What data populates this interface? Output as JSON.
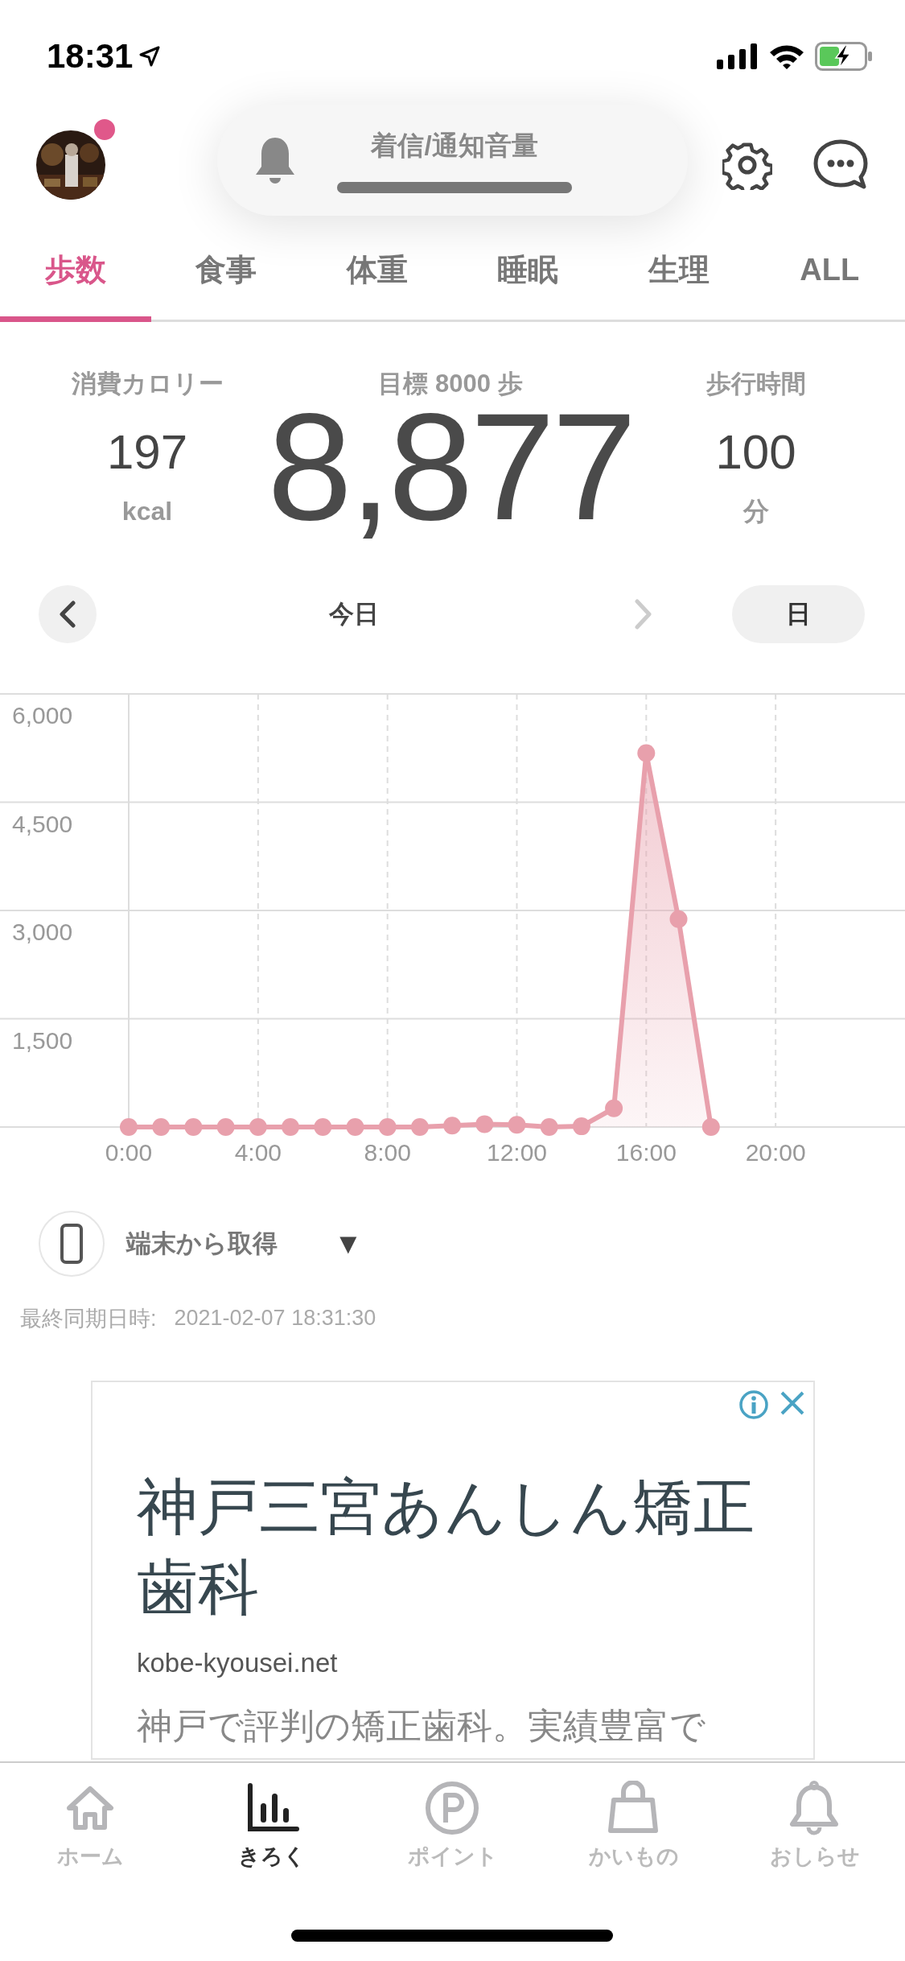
{
  "status_bar": {
    "time": "18:31"
  },
  "header": {
    "notification_dot": true
  },
  "volume_hud": {
    "label": "着信/通知音量",
    "level": 1
  },
  "tabs": [
    {
      "label": "歩数",
      "selected": true
    },
    {
      "label": "食事",
      "selected": false
    },
    {
      "label": "体重",
      "selected": false
    },
    {
      "label": "睡眠",
      "selected": false
    },
    {
      "label": "生理",
      "selected": false
    },
    {
      "label": "ALL",
      "selected": false
    }
  ],
  "stats": [
    {
      "kind": "side",
      "label": "消費カロリー",
      "value": "197",
      "unit": "kcal"
    },
    {
      "kind": "main",
      "label": "目標 8000 歩",
      "value": "8,877"
    },
    {
      "kind": "side",
      "label": "歩行時間",
      "value": "100",
      "unit": "分"
    }
  ],
  "date_nav": {
    "label": "今日",
    "next_enabled": false,
    "period": "日"
  },
  "chart": {
    "chart_data": {
      "type": "area",
      "x": [
        0,
        1,
        2,
        3,
        4,
        5,
        6,
        7,
        8,
        9,
        10,
        11,
        12,
        13,
        14,
        15,
        16,
        17,
        18
      ],
      "grid": true,
      "series": [
        {
          "color": "#e8a0ac",
          "values": [
            0,
            0,
            0,
            0,
            0,
            0,
            0,
            0,
            0,
            0,
            20,
            40,
            30,
            0,
            10,
            260,
            5180,
            2880,
            0
          ]
        }
      ],
      "xlim": [
        0,
        24
      ],
      "ylim": [
        0,
        6000
      ],
      "xticks": [
        {
          "value": 0,
          "label": "0:00"
        },
        {
          "value": 4,
          "label": "4:00"
        },
        {
          "value": 8,
          "label": "8:00"
        },
        {
          "value": 12,
          "label": "12:00"
        },
        {
          "value": 16,
          "label": "16:00"
        },
        {
          "value": 20,
          "label": "20:00"
        }
      ],
      "yticks": [
        {
          "value": 1500,
          "label": "1,500"
        },
        {
          "value": 3000,
          "label": "3,000"
        },
        {
          "value": 4500,
          "label": "4,500"
        },
        {
          "value": 6000,
          "label": "6,000"
        }
      ]
    }
  },
  "source": {
    "label": "端末から取得",
    "caret": "▼"
  },
  "sync": {
    "label": "最終同期日時:",
    "value": "2021-02-07 18:31:30"
  },
  "ad": {
    "title": "神戸三宮あんしん矯正歯科",
    "url": "kobe-kyousei.net",
    "description": "神戸で評判の矯正歯科。実績豊富で"
  },
  "bottom_nav": [
    {
      "label": "ホーム",
      "selected": false
    },
    {
      "label": "きろく",
      "selected": true
    },
    {
      "label": "ポイント",
      "selected": false
    },
    {
      "label": "かいもの",
      "selected": false
    },
    {
      "label": "おしらせ",
      "selected": false
    }
  ]
}
